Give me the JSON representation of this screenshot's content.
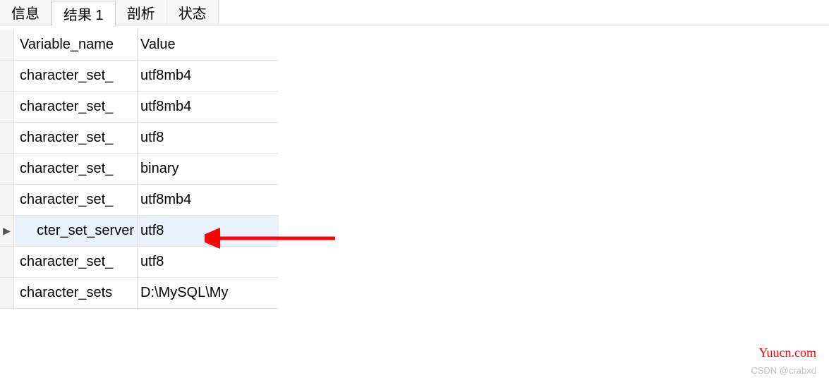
{
  "tabs": [
    {
      "label": "信息"
    },
    {
      "label": "结果 1"
    },
    {
      "label": "剖析"
    },
    {
      "label": "状态"
    }
  ],
  "active_tab_index": 1,
  "table": {
    "headers": {
      "col1": "Variable_name",
      "col2": "Value"
    },
    "rows": [
      {
        "col1": "character_set_",
        "col2": "utf8mb4"
      },
      {
        "col1": "character_set_",
        "col2": "utf8mb4"
      },
      {
        "col1": "character_set_",
        "col2": "utf8"
      },
      {
        "col1": "character_set_",
        "col2": "binary"
      },
      {
        "col1": "character_set_",
        "col2": "utf8mb4"
      },
      {
        "col1": "cter_set_server",
        "col2": "utf8"
      },
      {
        "col1": "character_set_",
        "col2": "utf8"
      },
      {
        "col1": "character_sets",
        "col2": "D:\\MySQL\\My"
      }
    ],
    "selected_row_index": 5,
    "row_marker_glyph": "▶"
  },
  "annotation": {
    "arrow_color": "#fe0101"
  },
  "watermark1": "Yuucn.com",
  "watermark2": "CSDN @crabxd"
}
